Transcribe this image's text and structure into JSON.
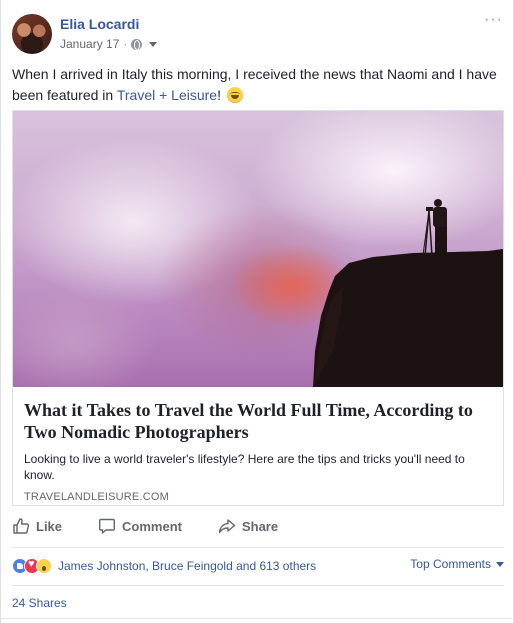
{
  "post": {
    "author": "Elia Locardi",
    "date": "January 17",
    "separator": "·",
    "privacy_icon": "globe-icon",
    "more_label": "···",
    "text_before": "When I arrived in Italy this morning, I received the news that Naomi and I have been featured in ",
    "text_link": "Travel + Leisure",
    "text_after": "!",
    "emoji_icon": "grinning-face-icon"
  },
  "preview": {
    "title": "What it Takes to Travel the World Full Time, According to Two Nomadic Photographers",
    "description": "Looking to live a world traveler's lifestyle? Here are the tips and tricks you'll need to know.",
    "domain": "TRAVELANDLEISURE.COM"
  },
  "actions": {
    "like": "Like",
    "comment": "Comment",
    "share": "Share"
  },
  "reactions": {
    "icons": [
      "like-reaction-icon",
      "love-reaction-icon",
      "wow-reaction-icon"
    ],
    "summary": "James Johnston, Bruce Feingold and 613 others",
    "sort_label": "Top Comments"
  },
  "shares": "24 Shares",
  "colors": {
    "link": "#365899",
    "text": "#1d2129",
    "muted": "#606770"
  }
}
